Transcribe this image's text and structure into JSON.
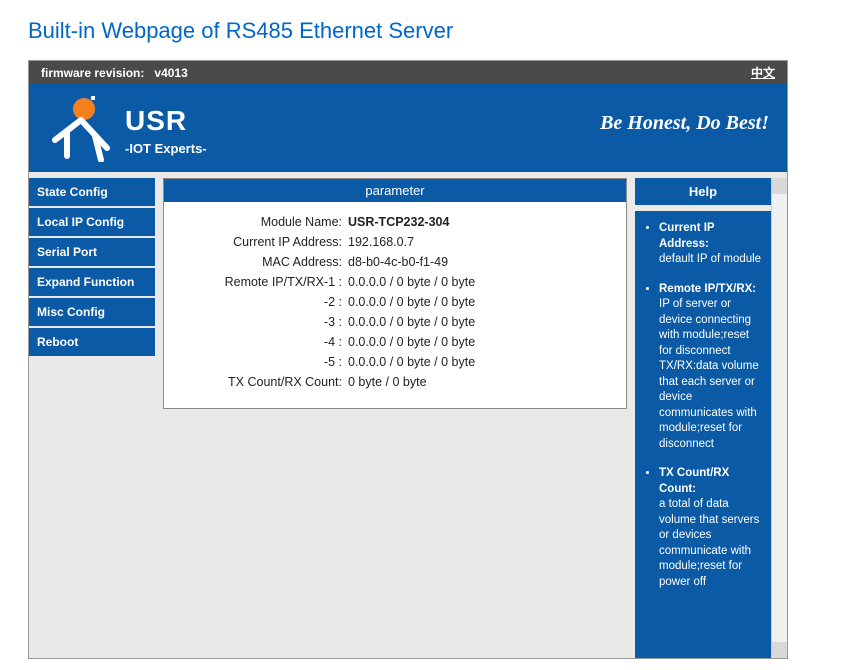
{
  "page_title": "Built-in Webpage of RS485 Ethernet Server",
  "topbar": {
    "firmware_label": "firmware revision:",
    "firmware_value": "v4013",
    "lang_link": "中文"
  },
  "brand": {
    "name": "USR",
    "subtitle": "-IOT Experts-",
    "slogan": "Be Honest, Do Best!"
  },
  "sidebar": {
    "items": [
      "State Config",
      "Local IP Config",
      "Serial Port",
      "Expand Function",
      "Misc Config",
      "Reboot"
    ]
  },
  "panel": {
    "heading": "parameter",
    "rows": [
      {
        "label": "Module Name:",
        "value": "USR-TCP232-304",
        "bold": true
      },
      {
        "label": "Current IP Address:",
        "value": "192.168.0.7"
      },
      {
        "label": "MAC Address:",
        "value": "d8-b0-4c-b0-f1-49"
      },
      {
        "label": "Remote IP/TX/RX-1 :",
        "value": "0.0.0.0 / 0 byte / 0 byte"
      },
      {
        "label": "-2 :",
        "value": "0.0.0.0 / 0 byte / 0 byte"
      },
      {
        "label": "-3 :",
        "value": "0.0.0.0 / 0 byte / 0 byte"
      },
      {
        "label": "-4 :",
        "value": "0.0.0.0 / 0 byte / 0 byte"
      },
      {
        "label": "-5 :",
        "value": "0.0.0.0 / 0 byte / 0 byte"
      },
      {
        "label": "TX Count/RX Count:",
        "value": "0 byte / 0 byte"
      }
    ]
  },
  "help": {
    "heading": "Help",
    "items": [
      {
        "title": "Current IP Address:",
        "body": "default IP of module"
      },
      {
        "title": "Remote IP/TX/RX:",
        "body": "IP of server or device connecting with module;reset for disconnect TX/RX:data volume that each server or device communicates with module;reset for disconnect"
      },
      {
        "title": "TX Count/RX Count:",
        "body": "a total of data volume that servers or devices communicate with module;reset for power off"
      }
    ]
  }
}
